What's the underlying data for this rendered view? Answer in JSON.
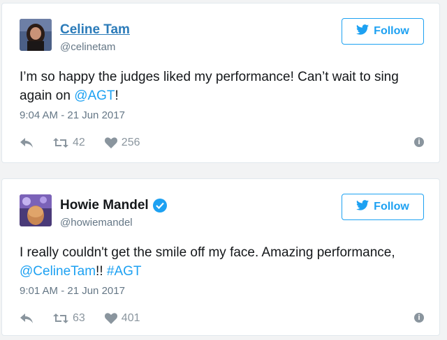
{
  "tweets": [
    {
      "name": "Celine Tam",
      "handle": "@celinetam",
      "follow_label": "Follow",
      "text_parts": {
        "a": "I’m so happy the judges liked my performance! Can’t wait to sing again on ",
        "b": "@AGT",
        "c": "!"
      },
      "timestamp": "9:04 AM - 21 Jun 2017",
      "retweets": "42",
      "likes": "256"
    },
    {
      "name": "Howie Mandel",
      "handle": "@howiemandel",
      "follow_label": "Follow",
      "text_parts": {
        "a": "I really couldn't get the smile off my face. Amazing performance, ",
        "b": "@CelineTam",
        "c": "!! ",
        "d": "#AGT"
      },
      "timestamp": "9:01 AM - 21 Jun 2017",
      "retweets": "63",
      "likes": "401"
    }
  ],
  "colors": {
    "accent": "#1da1f2",
    "muted": "#657786",
    "link": "#2b7bb9"
  },
  "icons": {
    "reply": "reply-icon",
    "retweet": "retweet-icon",
    "like": "heart-icon",
    "info": "info-icon",
    "bird": "twitter-bird-icon",
    "verified": "verified-badge-icon"
  }
}
